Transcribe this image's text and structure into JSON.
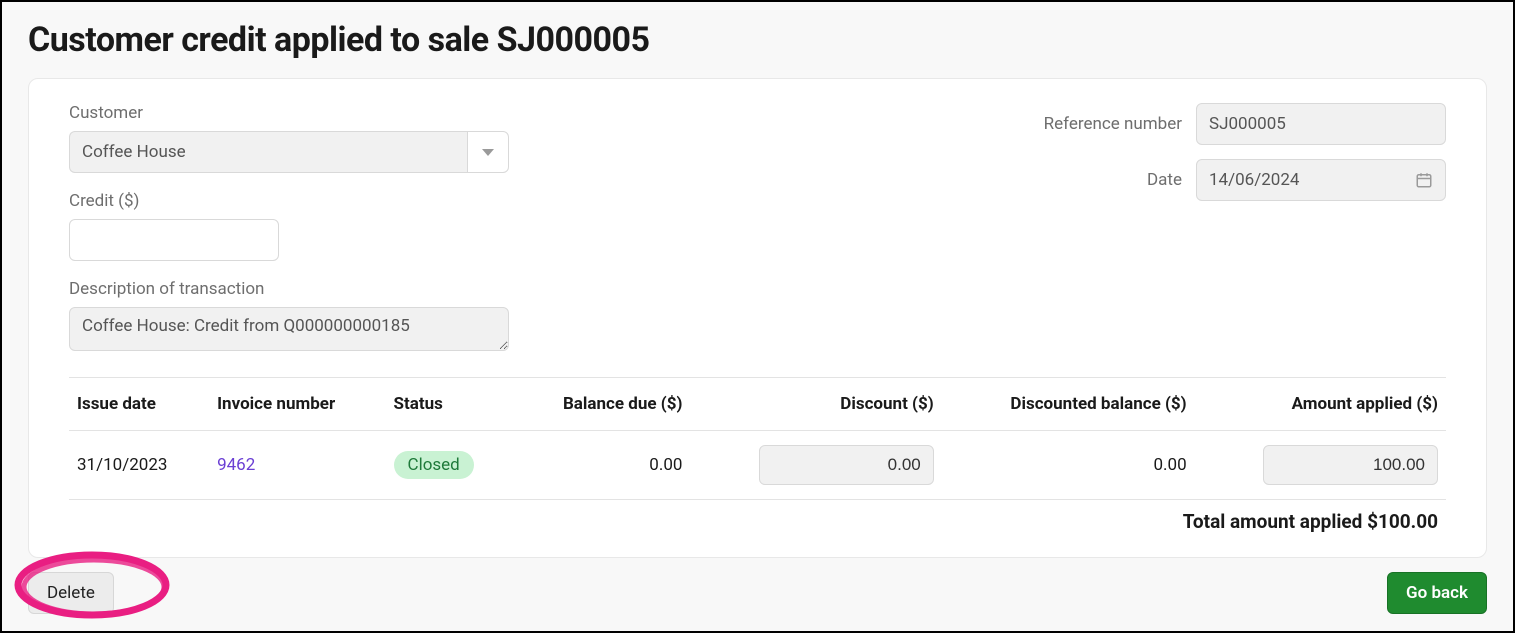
{
  "page": {
    "title": "Customer credit applied to sale SJ000005"
  },
  "form": {
    "customer_label": "Customer",
    "customer_value": "Coffee House",
    "credit_label": "Credit ($)",
    "credit_value": "",
    "description_label": "Description of transaction",
    "description_value": "Coffee House: Credit from Q000000000185",
    "reference_label": "Reference number",
    "reference_value": "SJ000005",
    "date_label": "Date",
    "date_value": "14/06/2024"
  },
  "table": {
    "headers": {
      "issue_date": "Issue date",
      "invoice_number": "Invoice number",
      "status": "Status",
      "balance_due": "Balance due ($)",
      "discount": "Discount ($)",
      "discounted_balance": "Discounted balance ($)",
      "amount_applied": "Amount applied ($)"
    },
    "rows": [
      {
        "issue_date": "31/10/2023",
        "invoice_number": "9462",
        "status": "Closed",
        "balance_due": "0.00",
        "discount": "0.00",
        "discounted_balance": "0.00",
        "amount_applied": "100.00"
      }
    ],
    "total_label": "Total amount applied ",
    "total_value": "$100.00"
  },
  "actions": {
    "delete": "Delete",
    "go_back": "Go back"
  }
}
